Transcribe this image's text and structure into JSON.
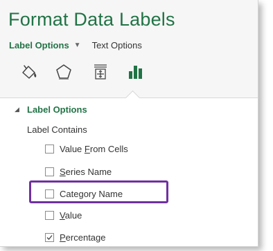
{
  "panel": {
    "title": "Format Data Labels",
    "tabs": {
      "active": "Label Options",
      "other": "Text Options"
    },
    "icons": [
      "fill-line-icon",
      "effects-icon",
      "size-properties-icon",
      "label-options-icon"
    ],
    "accent_color": "#217346",
    "highlight_color": "#7030a0"
  },
  "section": {
    "title": "Label Options",
    "sub_label": "Label Contains",
    "options": [
      {
        "pre": "Value ",
        "key": "F",
        "post": "rom Cells",
        "checked": false
      },
      {
        "pre": "",
        "key": "S",
        "post": "eries Name",
        "checked": false
      },
      {
        "pre": "Cate",
        "key": "g",
        "post": "ory Name",
        "checked": false
      },
      {
        "pre": "",
        "key": "V",
        "post": "alue",
        "checked": false
      },
      {
        "pre": "",
        "key": "P",
        "post": "ercentage",
        "checked": true
      }
    ]
  }
}
